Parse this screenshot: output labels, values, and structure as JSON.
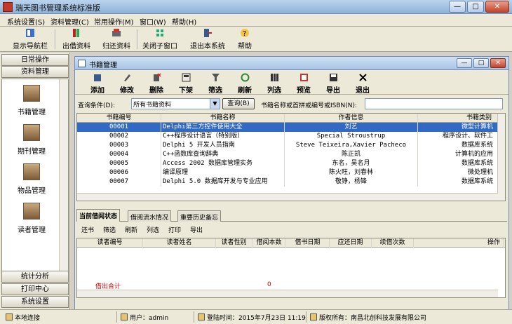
{
  "window": {
    "title": "瑞天图书管理系统标准版",
    "min": "—",
    "max": "□",
    "close": "✕"
  },
  "menu": [
    "系统设置(S)",
    "资料管理(C)",
    "常用操作(M)",
    "窗口(W)",
    "帮助(H)"
  ],
  "toolbar": [
    {
      "label": "显示导航栏",
      "icon": "navigation-icon"
    },
    {
      "label": "出借资料",
      "icon": "lend-book-icon"
    },
    {
      "label": "归还资料",
      "icon": "return-book-icon"
    },
    {
      "label": "关闭子窗口",
      "icon": "close-child-window-icon"
    },
    {
      "label": "退出本系统",
      "icon": "exit-system-icon"
    },
    {
      "label": "帮助",
      "icon": "help-icon"
    }
  ],
  "nav": {
    "top_headers": [
      "日常操作",
      "资料管理"
    ],
    "items": [
      {
        "label": "书籍管理",
        "icon": "books-icon"
      },
      {
        "label": "期刊管理",
        "icon": "periodical-icon"
      },
      {
        "label": "物品管理",
        "icon": "items-icon"
      },
      {
        "label": "读者管理",
        "icon": "reader-icon"
      }
    ],
    "bottom_headers": [
      "统计分析",
      "打印中心",
      "系统设置"
    ]
  },
  "child": {
    "title": "书籍管理",
    "tools": [
      {
        "label": "添加",
        "icon": "add-icon"
      },
      {
        "label": "修改",
        "icon": "edit-icon"
      },
      {
        "label": "删除",
        "icon": "delete-icon"
      },
      {
        "label": "下架",
        "icon": "shelf-off-icon"
      },
      {
        "label": "筛选",
        "icon": "filter-icon"
      },
      {
        "label": "刷新",
        "icon": "refresh-icon"
      },
      {
        "label": "列选",
        "icon": "columns-icon"
      },
      {
        "label": "预览",
        "icon": "preview-icon"
      },
      {
        "label": "导出",
        "icon": "export-icon"
      },
      {
        "label": "退出",
        "icon": "exit-icon"
      }
    ],
    "query": {
      "label": "查询条件(D):",
      "selected": "所有书籍资料",
      "button": "查询(B)",
      "search_label": "书籍名称或首拼或编号或ISBN(N):",
      "search_value": ""
    },
    "grid": {
      "columns": [
        "书籍编号",
        "书籍名称",
        "作者信息",
        "书籍类别"
      ],
      "rows": [
        [
          "00001",
          "Delphi第三方控件使用大全",
          "刘艺",
          "微型计算机"
        ],
        [
          "00002",
          "C++程序设计语言（特别版）",
          "Special Stroustrup",
          "程序设计、软件工"
        ],
        [
          "00003",
          "Delphi 5 开发人员指南",
          "Steve Teixeira,Xavier Pacheco",
          "数据库系统"
        ],
        [
          "00004",
          "C++函数库查询辞典",
          "陈正凯",
          "计算机的应用"
        ],
        [
          "00005",
          "Access 2002 数据库管理实务",
          "东名，吴名月",
          "数据库系统"
        ],
        [
          "00006",
          "编译原理",
          "陈火旺，刘春林",
          "微处理机"
        ],
        [
          "00007",
          "Delphi 5.0 数据库开发与专业应用",
          "敬铮，杨锋",
          "数据库系统"
        ]
      ],
      "selected_index": 0
    },
    "tabs": [
      "当前借阅状态",
      "借阅流水情况",
      "重要历史备忘"
    ],
    "subtools": [
      "还书",
      "筛选",
      "刷新",
      "列选",
      "打印",
      "导出"
    ],
    "grid2": {
      "columns": [
        "读者编号",
        "读者姓名",
        "读者性别",
        "借阅本数",
        "借书日期",
        "应还日期",
        "续借次数",
        "操作"
      ],
      "footer_label": "借出合计",
      "footer_value": "0"
    }
  },
  "status": {
    "connection": "本地连接",
    "user": "用户：admin",
    "login_time": "登陆时间：2015年7月23日 11:19",
    "copyright": "版权所有：南昌北创科技发展有限公司"
  },
  "colors": {
    "selection": "#316ac5",
    "footer_red": "#d40000",
    "title_blue": "#a9c4e4"
  }
}
